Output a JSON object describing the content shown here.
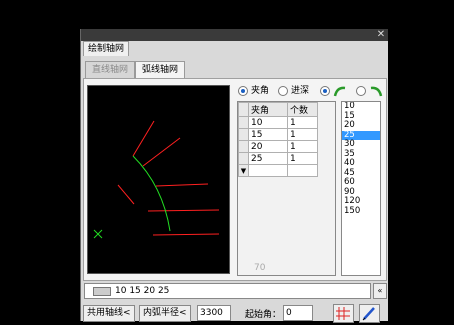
{
  "window": {
    "title": "绘制轴网",
    "close_icon": "close-icon"
  },
  "tabs": [
    {
      "label": "直线轴网",
      "active": false
    },
    {
      "label": "弧线轴网",
      "active": true
    }
  ],
  "options": {
    "angle_label": "夹角",
    "angle_selected": true,
    "depth_label": "进深",
    "depth_selected": false,
    "mode_a_icon": "arc-green-icon",
    "mode_b_icon": "arc-green-icon"
  },
  "grid": {
    "headers": [
      "夹角",
      "个数"
    ],
    "rows": [
      {
        "angle": "10",
        "count": "1"
      },
      {
        "angle": "15",
        "count": "1"
      },
      {
        "angle": "20",
        "count": "1"
      },
      {
        "angle": "25",
        "count": "1"
      }
    ],
    "footer_total": "70"
  },
  "value_list": {
    "items": [
      "10",
      "15",
      "20",
      "25",
      "30",
      "35",
      "40",
      "45",
      "60",
      "90",
      "120",
      "150"
    ],
    "selected": "25"
  },
  "command": {
    "text": "10 15 20 25",
    "expand_icon": "double-chevron-left-icon"
  },
  "bottom": {
    "shared_axis_label": "共用轴线<",
    "inner_radius_label": "内弧半径<",
    "inner_radius_value": "3300",
    "start_angle_label": "起始角：",
    "start_angle_value": "0",
    "grid_icon": "grid-pick-icon",
    "pen_icon": "pen-icon"
  },
  "colors": {
    "radial_line": "#ff2020",
    "arc": "#22dd22",
    "highlight": "#3399ff"
  }
}
